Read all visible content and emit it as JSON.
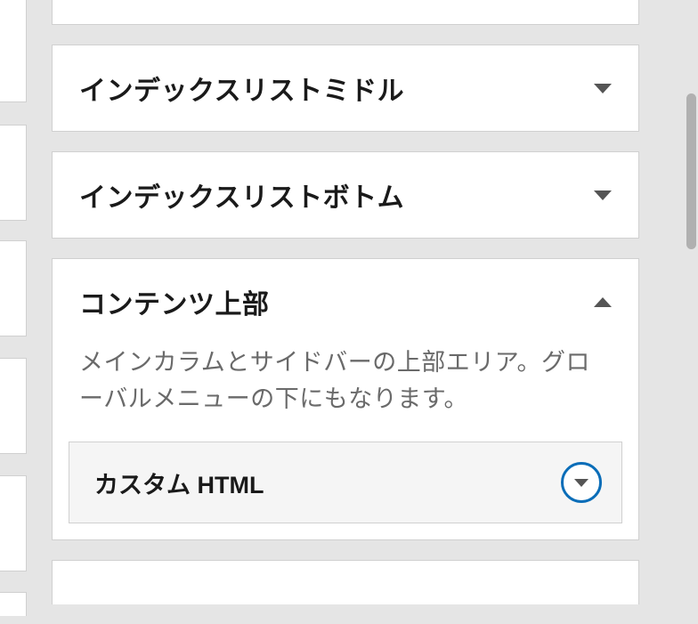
{
  "panels": {
    "index_middle": {
      "title": "インデックスリストミドル"
    },
    "index_bottom": {
      "title": "インデックスリストボトム"
    },
    "content_top": {
      "title": "コンテンツ上部",
      "description": "メインカラムとサイドバーの上部エリア。グローバルメニューの下にもなります。"
    }
  },
  "widget": {
    "title": "カスタム HTML"
  }
}
